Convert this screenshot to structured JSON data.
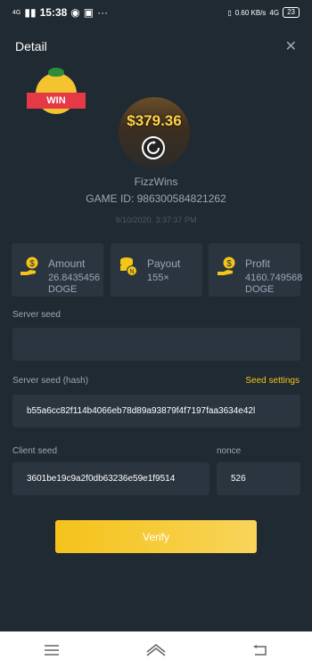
{
  "statusbar": {
    "network": "4G",
    "time": "15:38",
    "speed": "0.60 KB/s",
    "network2": "4G",
    "battery": "23"
  },
  "header": {
    "title": "Detail",
    "close_icon": "close-icon"
  },
  "badge": {
    "text": "WIN"
  },
  "game": {
    "avatar_amount": "$379.36",
    "username": "FizzWins",
    "game_id": "GAME ID: 986300584821262",
    "datetime": "9/10/2020, 3:37:37 PM"
  },
  "stats": [
    {
      "label": "Amount",
      "value": "26.8435456",
      "unit": "DOGE",
      "icon": "hand-coin-icon"
    },
    {
      "label": "Payout",
      "value": "155×",
      "unit": "",
      "icon": "coin-stack-icon"
    },
    {
      "label": "Profit",
      "value": "4160.749568",
      "unit": "DOGE",
      "icon": "hand-coin-icon"
    }
  ],
  "server_seed": {
    "label": "Server seed",
    "value": ""
  },
  "server_hash": {
    "label": "Server seed (hash)",
    "value": "b55a6cc82f114b4066eb78d89a93879f4f7197faa3634e42l",
    "link": "Seed settings"
  },
  "client_seed": {
    "label": "Client seed",
    "value": "3601be19c9a2f0db63236e59e1f9514"
  },
  "nonce": {
    "label": "nonce",
    "value": "526"
  },
  "verify": {
    "label": "Verify"
  },
  "colors": {
    "background": "#1f2a33",
    "card": "#2a3540",
    "accent": "#f5c518"
  }
}
